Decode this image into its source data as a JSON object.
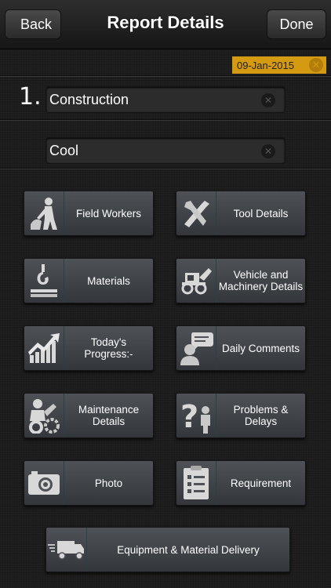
{
  "navbar": {
    "title": "Report Details",
    "back_label": "Back",
    "done_label": "Done"
  },
  "date": {
    "value": "09-Jan-2015",
    "clear_icon": "close-icon"
  },
  "step": {
    "number": "1.",
    "project_field": {
      "value": "Construction",
      "clear_icon": "clear-icon"
    },
    "weather_field": {
      "value": "Cool",
      "clear_icon": "clear-icon"
    }
  },
  "tiles": [
    {
      "label": "Field Workers",
      "icon": "worker-icon"
    },
    {
      "label": "Tool Details",
      "icon": "tools-icon"
    },
    {
      "label": "Materials",
      "icon": "crane-hook-icon"
    },
    {
      "label": "Vehicle and Machinery Details",
      "label_html": "Vehicle and\nMachinery Details",
      "icon": "tractor-icon"
    },
    {
      "label": "Today's Progress:-",
      "icon": "progress-chart-icon"
    },
    {
      "label": "Daily Comments",
      "icon": "comment-icon"
    },
    {
      "label": "Maintenance Details",
      "icon": "maintenance-icon"
    },
    {
      "label": "Problems & Delays",
      "icon": "question-icon"
    },
    {
      "label": "Photo",
      "icon": "camera-icon"
    },
    {
      "label": "Requirement",
      "icon": "checklist-icon"
    },
    {
      "label": "Equipment & Material Delivery",
      "icon": "truck-icon"
    }
  ],
  "colors": {
    "date_badge": "#d39a12",
    "tile_bg": "#4e5257",
    "background": "#1c1c1c"
  }
}
